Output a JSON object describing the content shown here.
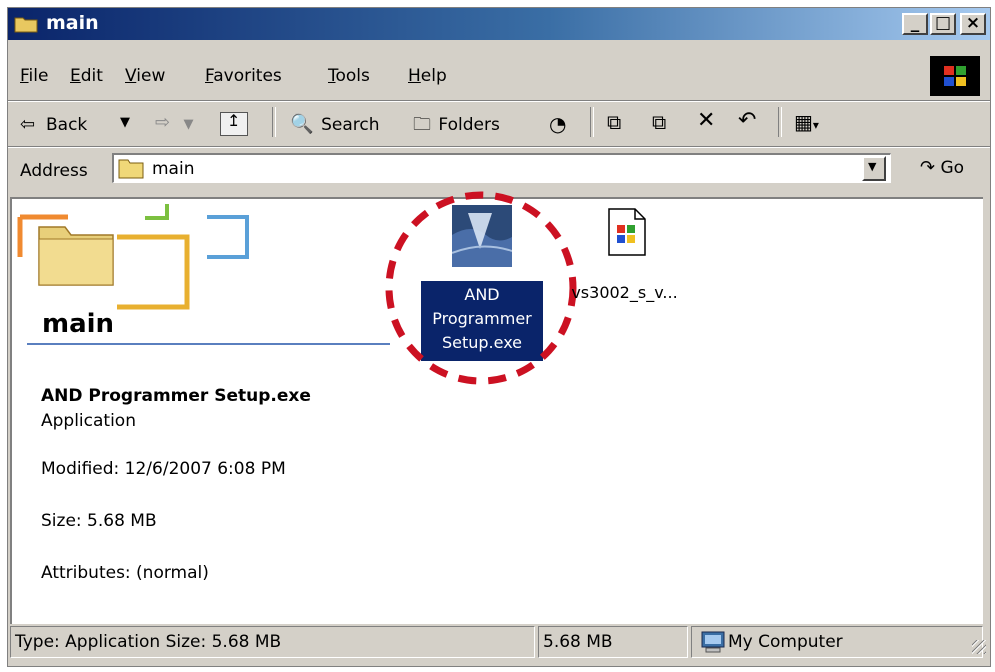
{
  "window": {
    "title": "main",
    "title_icon": "folder-icon"
  },
  "window_controls": {
    "minimize": "_",
    "maximize": "□",
    "close": "×"
  },
  "menu": {
    "items": [
      "File",
      "Edit",
      "View",
      "Favorites",
      "Tools",
      "Help"
    ]
  },
  "toolbar": {
    "back_label": "Back",
    "search_label": "Search",
    "folders_label": "Folders"
  },
  "address": {
    "label": "Address",
    "value": "main",
    "go_label": "Go"
  },
  "panel": {
    "folder_title": "main",
    "selected_name": "AND Programmer Setup.exe",
    "selected_type": "Application",
    "modified": "Modified: 12/6/2007 6:08 PM",
    "size": "Size: 5.68 MB",
    "attributes": "Attributes: (normal)"
  },
  "files": [
    {
      "name_lines": [
        "AND",
        "Programmer",
        "Setup.exe"
      ],
      "icon": "installer-icon",
      "selected": true
    },
    {
      "name": "vs3002_s_v...",
      "icon": "media-file-icon",
      "selected": false
    }
  ],
  "status": {
    "type_size": "Type: Application Size: 5.68 MB",
    "size": "5.68 MB",
    "zone": "My Computer"
  },
  "colors": {
    "title_gradient_start": "#0a246a",
    "title_gradient_end": "#a6caf0",
    "face": "#d4d0c8",
    "selection": "#0a246a",
    "highlight_circle": "#cc1122",
    "panel_accent": "#5a7fbf"
  }
}
